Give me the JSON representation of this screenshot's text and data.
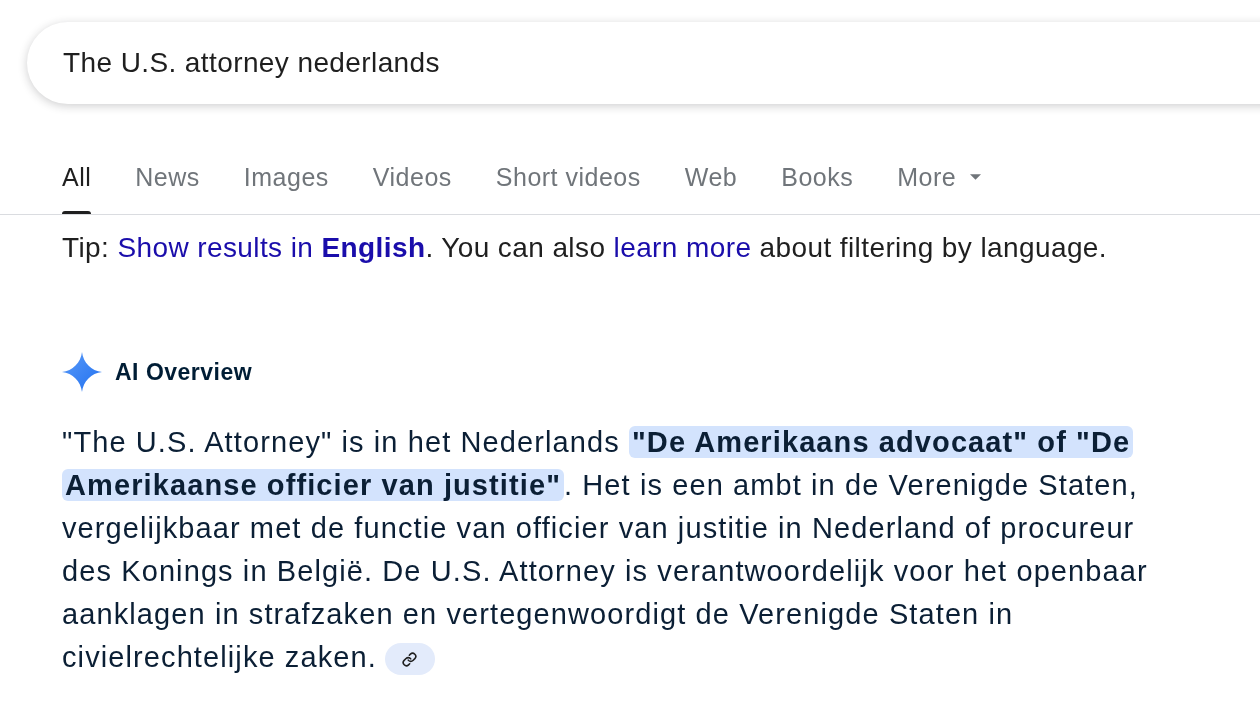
{
  "search": {
    "value": "The U.S. attorney nederlands"
  },
  "tabs": [
    {
      "label": "All",
      "selected": true,
      "kind": "tab"
    },
    {
      "label": "News",
      "selected": false,
      "kind": "tab"
    },
    {
      "label": "Images",
      "selected": false,
      "kind": "tab"
    },
    {
      "label": "Videos",
      "selected": false,
      "kind": "tab"
    },
    {
      "label": "Short videos",
      "selected": false,
      "kind": "tab"
    },
    {
      "label": "Web",
      "selected": false,
      "kind": "tab"
    },
    {
      "label": "Books",
      "selected": false,
      "kind": "tab"
    },
    {
      "label": "More",
      "selected": false,
      "kind": "menu"
    }
  ],
  "tip": [
    {
      "kind": "text",
      "text": "Tip: "
    },
    {
      "kind": "link",
      "text": "Show results in **English**"
    },
    {
      "kind": "text",
      "text": ". You can also "
    },
    {
      "kind": "link",
      "text": "learn more"
    },
    {
      "kind": "text",
      "text": " about filtering by language."
    }
  ],
  "ai_overview": {
    "title": "AI Overview",
    "parts": [
      {
        "kind": "text",
        "text": "\"The U.S. Attorney\" is in het Nederlands "
      },
      {
        "kind": "highlight",
        "text": "\"De Amerikaans advocaat\" of \"De Amerikaanse officier van justitie\""
      },
      {
        "kind": "text",
        "text": ". Het is een ambt in de Verenigde Staten, vergelijkbaar met de functie van officier van justitie in Nederland of procureur des Konings in België. De U.S. Attorney is verantwoordelijk voor het openbaar aanklagen in strafzaken en vertegenwoordigt de Verenigde Staten in civielrechtelijke zaken."
      }
    ]
  }
}
